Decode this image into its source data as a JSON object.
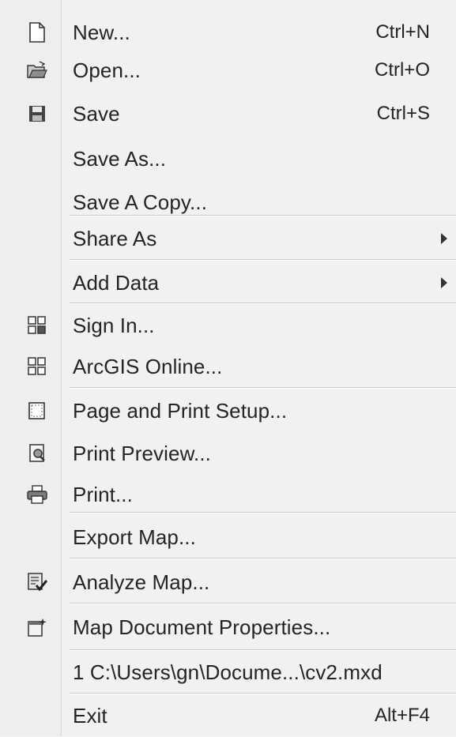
{
  "menu": {
    "items": [
      {
        "label": "New...",
        "shortcut": "Ctrl+N",
        "icon": "new-document-icon"
      },
      {
        "label": "Open...",
        "shortcut": "Ctrl+O",
        "icon": "open-folder-icon"
      },
      {
        "label": "Save",
        "shortcut": "Ctrl+S",
        "icon": "save-disk-icon"
      },
      {
        "label": "Save As...",
        "shortcut": ""
      },
      {
        "label": "Save A Copy...",
        "shortcut": ""
      },
      {
        "label": "Share As",
        "submenu": true
      },
      {
        "label": "Add Data",
        "submenu": true
      },
      {
        "label": "Sign In...",
        "icon": "sign-in-grid-icon"
      },
      {
        "label": "ArcGIS Online...",
        "icon": "arcgis-online-grid-icon"
      },
      {
        "label": "Page and Print Setup...",
        "icon": "page-setup-icon"
      },
      {
        "label": "Print Preview...",
        "icon": "print-preview-icon"
      },
      {
        "label": "Print...",
        "icon": "printer-icon"
      },
      {
        "label": "Export Map..."
      },
      {
        "label": "Analyze Map...",
        "icon": "analyze-map-icon"
      },
      {
        "label": "Map Document Properties...",
        "icon": "document-properties-icon"
      },
      {
        "label": "1 C:\\Users\\gn\\Docume...\\cv2.mxd"
      },
      {
        "label": "Exit",
        "shortcut": "Alt+F4"
      }
    ]
  }
}
